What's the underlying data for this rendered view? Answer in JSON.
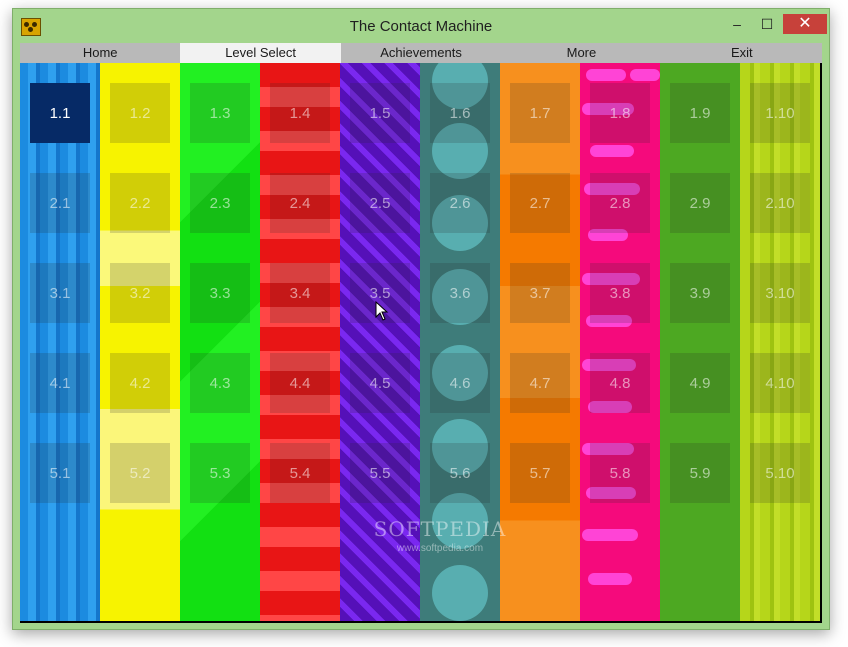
{
  "window": {
    "title": "The Contact Machine"
  },
  "title_buttons": {
    "minimize": "–",
    "maximize": "☐",
    "close": "✕"
  },
  "menu": [
    {
      "label": "Home",
      "active": false
    },
    {
      "label": "Level Select",
      "active": true
    },
    {
      "label": "Achievements",
      "active": false
    },
    {
      "label": "More",
      "active": false
    },
    {
      "label": "Exit",
      "active": false
    }
  ],
  "levels": {
    "selected": "1.1",
    "columns": [
      [
        "1.1",
        "2.1",
        "3.1",
        "4.1",
        "5.1"
      ],
      [
        "1.2",
        "2.2",
        "3.2",
        "4.2",
        "5.2"
      ],
      [
        "1.3",
        "2.3",
        "3.3",
        "4.3",
        "5.3"
      ],
      [
        "1.4",
        "2.4",
        "3.4",
        "4.4",
        "5.4"
      ],
      [
        "1.5",
        "2.5",
        "3.5",
        "4.5",
        "5.5"
      ],
      [
        "1.6",
        "2.6",
        "3.6",
        "4.6",
        "5.6"
      ],
      [
        "1.7",
        "2.7",
        "3.7",
        "4.7",
        "5.7"
      ],
      [
        "1.8",
        "2.8",
        "3.8",
        "4.8",
        "5.8"
      ],
      [
        "1.9",
        "2.9",
        "3.9",
        "4.9",
        "5.9"
      ],
      [
        "1.10",
        "2.10",
        "3.10",
        "4.10",
        "5.10"
      ]
    ]
  },
  "watermark": {
    "title": "SOFTPEDIA",
    "url": "www.softpedia.com"
  }
}
